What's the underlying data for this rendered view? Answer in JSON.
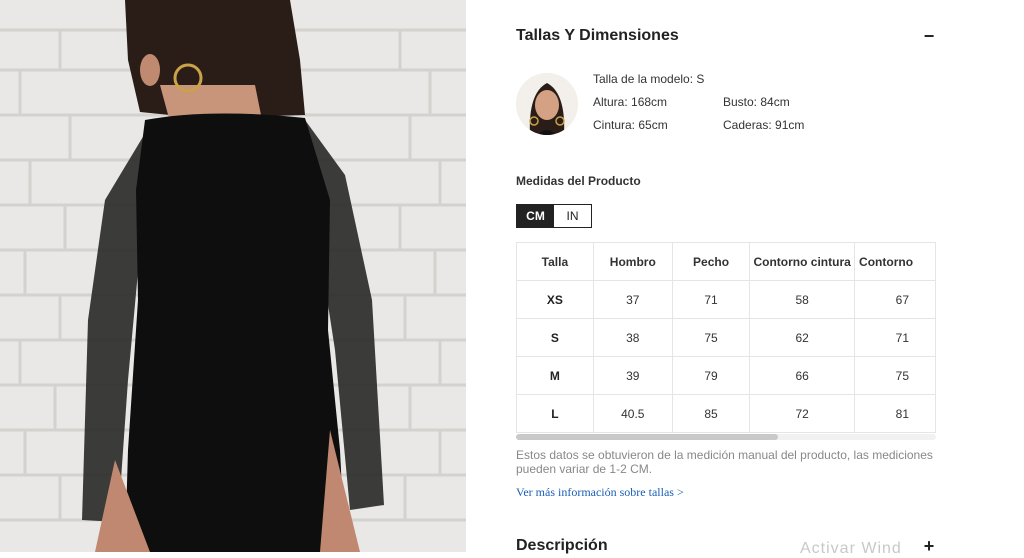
{
  "size_section": {
    "title": "Tallas Y Dimensiones",
    "toggle_symbol": "−"
  },
  "model": {
    "size_text": "Talla de la modelo: S",
    "height_text": "Altura: 168cm",
    "bust_text": "Busto: 84cm",
    "waist_text": "Cintura: 65cm",
    "hips_text": "Caderas: 91cm"
  },
  "measures": {
    "title": "Medidas del Producto",
    "units": [
      "CM",
      "IN"
    ],
    "active_unit": "CM"
  },
  "size_table": {
    "headers": [
      "Talla",
      "Hombro",
      "Pecho",
      "Contorno cintura",
      "Contorno"
    ],
    "rows": [
      [
        "XS",
        "37",
        "71",
        "58",
        "67"
      ],
      [
        "S",
        "38",
        "75",
        "62",
        "71"
      ],
      [
        "M",
        "39",
        "79",
        "66",
        "75"
      ],
      [
        "L",
        "40.5",
        "85",
        "72",
        "81"
      ]
    ]
  },
  "note": "Estos datos se obtuvieron de la medición manual del producto, las mediciones pueden variar de 1-2 CM.",
  "more_link": "Ver más información sobre tallas >",
  "description": {
    "title": "Descripción",
    "toggle_symbol": "+"
  },
  "watermark": "Activar Wind",
  "colors": {
    "active_unit_bg": "#222222",
    "link": "#1a5fb4",
    "note": "#888888"
  }
}
